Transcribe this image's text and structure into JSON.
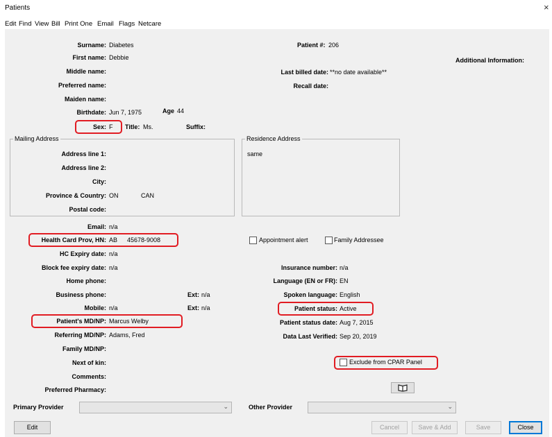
{
  "window": {
    "title": "Patients",
    "close": "×"
  },
  "menu": [
    "Edit",
    "Find",
    "View",
    "Bill",
    "Print One",
    "Email",
    "Flags",
    "Netcare"
  ],
  "patient": {
    "surname_label": "Surname:",
    "surname": "Diabetes",
    "first_label": "First name:",
    "first": "Debbie",
    "middle_label": "Middle name:",
    "preferred_label": "Preferred name:",
    "maiden_label": "Maiden name:",
    "birth_label": "Birthdate:",
    "birth": "Jun 7, 1975",
    "age_label": "Age",
    "age": "44",
    "sex_label": "Sex:",
    "sex": "F",
    "title_label": "Title:",
    "title": "Ms.",
    "suffix_label": "Suffix:",
    "number_label": "Patient #:",
    "number": "206",
    "additional_label": "Additional Information:",
    "last_billed_label": "Last billed date:",
    "last_billed": "**no date available**",
    "recall_label": "Recall date:"
  },
  "mailing": {
    "group": "Mailing Address",
    "line1_label": "Address line 1:",
    "line2_label": "Address line 2:",
    "city_label": "City:",
    "prov_label": "Province & Country:",
    "prov": "ON",
    "country": "CAN",
    "postal_label": "Postal code:"
  },
  "residence": {
    "group": "Residence Address",
    "value": "same"
  },
  "contact": {
    "email_label": "Email:",
    "email": "n/a",
    "hc_label": "Health Card Prov, HN:",
    "hc_prov": "AB",
    "hc_num": "45678-9008",
    "hc_expiry_label": "HC Expiry date:",
    "hc_expiry": "n/a",
    "block_label": "Block fee expiry date:",
    "block": "n/a",
    "home_label": "Home phone:",
    "business_label": "Business phone:",
    "ext_label": "Ext:",
    "ext_business": "n/a",
    "mobile_label": "Mobile:",
    "mobile": "n/a",
    "ext_mobile": "n/a",
    "md_label": "Patient's MD/NP:",
    "md": "Marcus Welby",
    "ref_label": "Referring MD/NP:",
    "ref": "Adams, Fred",
    "family_label": "Family MD/NP:",
    "kin_label": "Next of kin:",
    "comments_label": "Comments:",
    "pharmacy_label": "Preferred Pharmacy:"
  },
  "flags": {
    "appt_alert": "Appointment alert",
    "family_addressee": "Family Addressee",
    "exclude_cpar": "Exclude from CPAR Panel"
  },
  "right": {
    "insurance_label": "Insurance number:",
    "insurance": "n/a",
    "language_label": "Language (EN or FR):",
    "language": "EN",
    "spoken_label": "Spoken language:",
    "spoken": "English",
    "status_label": "Patient status:",
    "status": "Active",
    "status_date_label": "Patient status date:",
    "status_date": "Aug 7, 2015",
    "verified_label": "Data Last Verified:",
    "verified": "Sep 20, 2019"
  },
  "footer": {
    "primary_label": "Primary Provider",
    "other_label": "Other Provider",
    "edit": "Edit",
    "cancel": "Cancel",
    "save_add": "Save & Add",
    "save": "Save",
    "close": "Close"
  },
  "colors": {
    "highlight": "#e11b22",
    "pane": "#f0f0f0",
    "default_button": "#0078d7"
  }
}
